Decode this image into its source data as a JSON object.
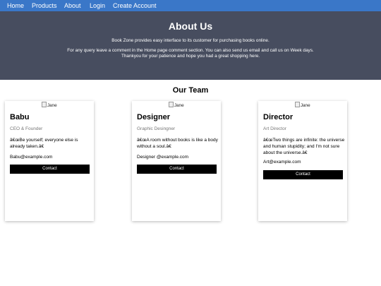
{
  "nav": {
    "items": [
      {
        "label": "Home"
      },
      {
        "label": "Products"
      },
      {
        "label": "About"
      },
      {
        "label": "Login"
      },
      {
        "label": "Create Account"
      }
    ]
  },
  "hero": {
    "title": "About Us",
    "line1": "Book Zone provides easy interface to its customer for purchasing books online.",
    "line2": "For any query leave a comment in the Home page comment section. You can also send us email and call us on Week days.",
    "line3": "Thankyou for your patience and hope you had a great shopping here."
  },
  "team": {
    "title": "Our Team",
    "members": [
      {
        "img_alt": "Jane",
        "name": "Babu",
        "role": "CEO & Founder",
        "quote": "â€œBe yourself; everyone else is already taken.â€",
        "email": "Babu@example.com",
        "button": "Contact"
      },
      {
        "img_alt": "Jane",
        "name": "Designer",
        "role": "Graphic Desingner",
        "quote": "â€œA room without books is like a body without a soul.â€",
        "email": "Designer @example.com",
        "button": "Contact"
      },
      {
        "img_alt": "Jane",
        "name": "Director",
        "role": "Art Director",
        "quote": "â€œTwo things are infinite: the universe and human stupidity; and I'm not sure about the universe.â€",
        "email": "Art@example.com",
        "button": "Contact"
      }
    ]
  },
  "colors": {
    "navbar": "#3a77c8",
    "hero": "#474d5f",
    "button": "#000000"
  }
}
